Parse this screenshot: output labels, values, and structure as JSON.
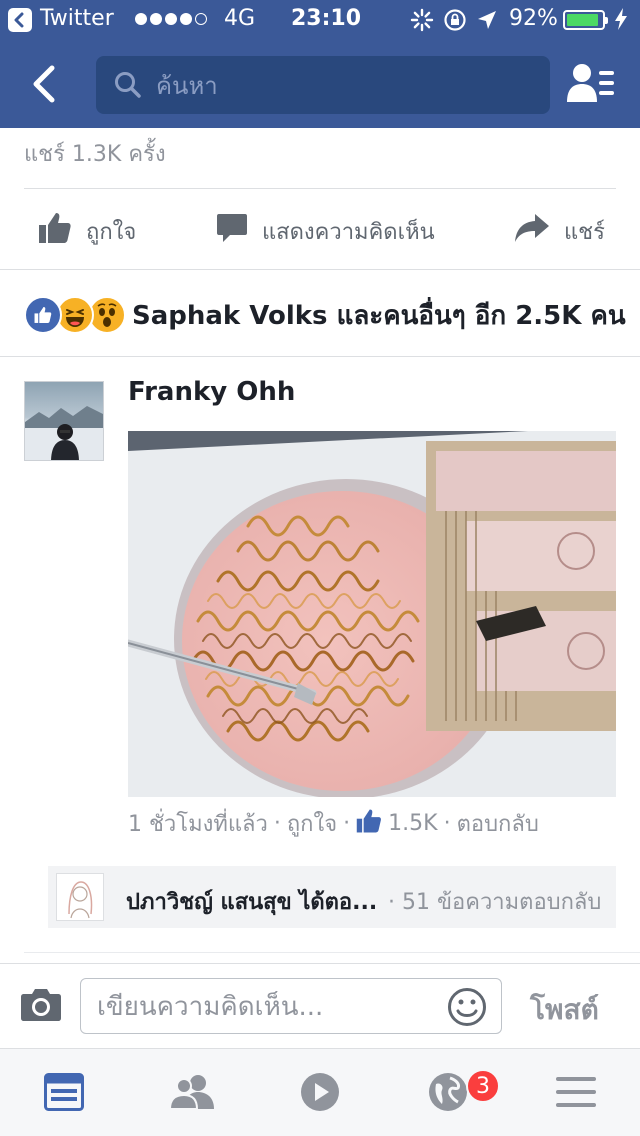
{
  "status_bar": {
    "app_name": "Twitter",
    "network": "4G",
    "time": "23:10",
    "battery_percent": "92%",
    "battery_level": 0.92,
    "signal_bars_filled": 4,
    "signal_bars_total": 5
  },
  "nav": {
    "search_placeholder": "ค้นหา"
  },
  "post_stats": {
    "shares": "แชร์ 1.3K ครั้ง"
  },
  "actions": {
    "like": "ถูกใจ",
    "comment": "แสดงความคิดเห็น",
    "share": "แชร์"
  },
  "reactions": {
    "text": "Saphak Volks และคนอื่นๆ อีก 2.5K คน",
    "icons": [
      "like-icon",
      "laugh-icon",
      "wow-icon"
    ]
  },
  "comment": {
    "author": "Franky Ohh",
    "time": "1 ชั่วโมงที่แล้ว",
    "separator": "·",
    "like_label": "ถูกใจ",
    "like_count": "1.5K",
    "reply_label": "ตอบกลับ"
  },
  "reply_preview": {
    "name": "ปภาวิชญ์ แสนสุข ได้ตอ...",
    "count": "· 51 ข้อความตอบกลับ"
  },
  "composer": {
    "placeholder": "เขียนความคิดเห็น...",
    "post_label": "โพสต์"
  },
  "tabs": {
    "notifications_badge": "3",
    "active_tab": "news-feed"
  },
  "colors": {
    "brand": "#3b5998",
    "like_blue": "#4267b2",
    "badge_red": "#fa3e3e"
  }
}
